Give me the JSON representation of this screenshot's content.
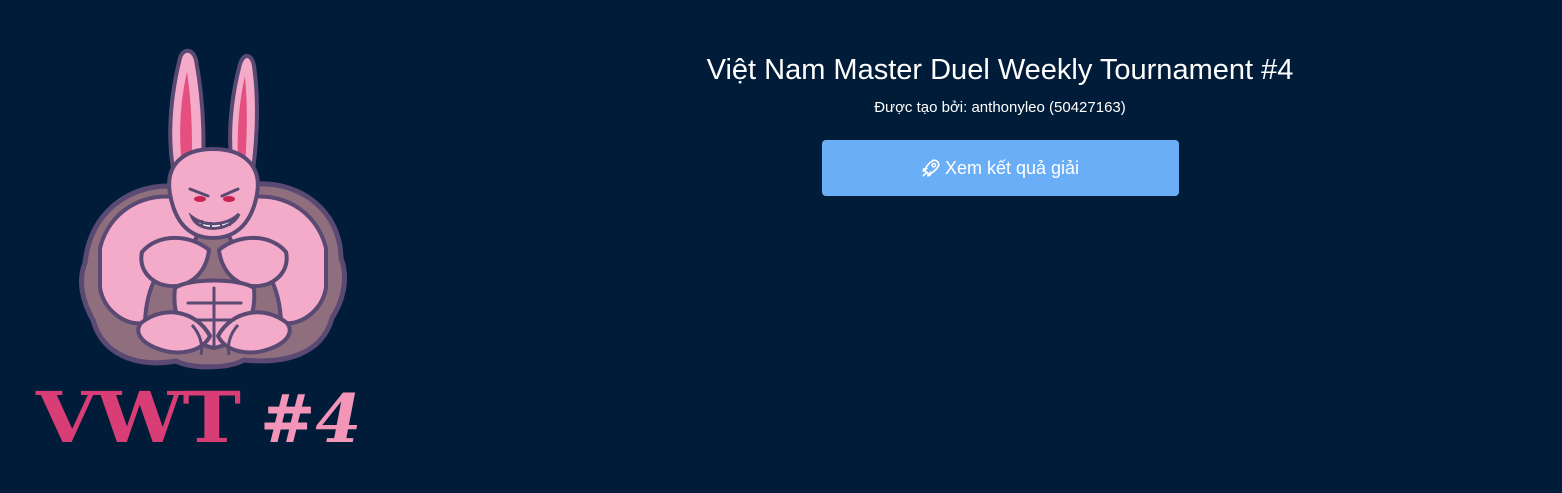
{
  "logo": {
    "mascot_icon": "muscular-pink-rabbit-icon",
    "text_main": "VWT",
    "text_number": "#4",
    "colors": {
      "rabbit_pink": "#f4aac9",
      "rabbit_outline": "#5a4a73",
      "text_main": "#d83d75",
      "text_number": "#f295b8"
    }
  },
  "tournament": {
    "title": "Việt Nam Master Duel Weekly Tournament #4",
    "creator": "Được tạo bởi: anthonyleo (50427163)"
  },
  "actions": {
    "view_results_label": "Xem kết quả giải",
    "view_results_icon": "rocket-icon"
  },
  "colors": {
    "background": "#011c38",
    "button": "#6aaef8",
    "text": "#ffffff"
  }
}
